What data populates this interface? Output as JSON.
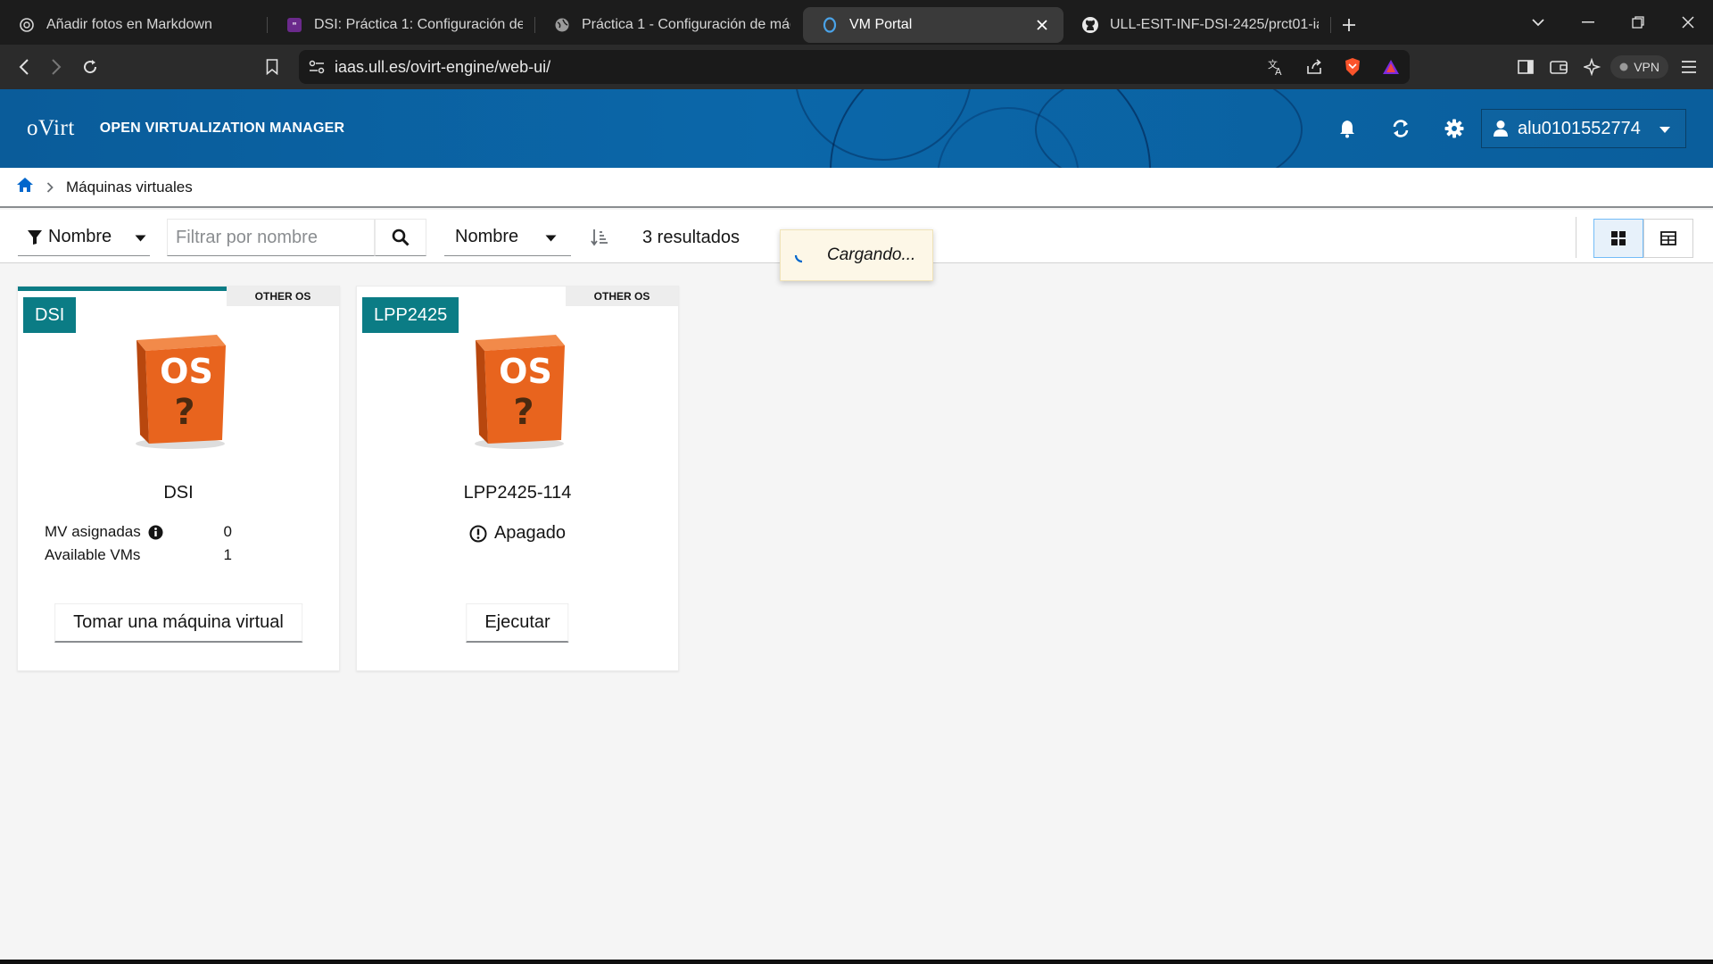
{
  "browser": {
    "tabs": [
      {
        "label": "Añadir fotos en Markdown",
        "icon": "openai-icon"
      },
      {
        "label": "DSI: Práctica 1: Configuración de m",
        "icon": "teams-icon"
      },
      {
        "label": "Práctica 1 - Configuración de máqu",
        "icon": "globe-icon"
      },
      {
        "label": "VM Portal",
        "icon": "ovirt-icon",
        "active": true
      },
      {
        "label": "ULL-ESIT-INF-DSI-2425/prct01-iaas",
        "icon": "github-icon"
      }
    ],
    "url": "iaas.ull.es/ovirt-engine/web-ui/",
    "vpn_label": "VPN"
  },
  "header": {
    "logo": "oVirt",
    "product": "OPEN VIRTUALIZATION MANAGER",
    "username": "alu0101552774"
  },
  "toast": {
    "text": "Cargando..."
  },
  "breadcrumb": {
    "current": "Máquinas virtuales"
  },
  "filter": {
    "field_label": "Nombre",
    "placeholder": "Filtrar por nombre",
    "sort_label": "Nombre",
    "results": "3 resultados"
  },
  "cards": [
    {
      "pool_label": "DSI",
      "os": "OTHER OS",
      "name": "DSI",
      "assigned_label": "MV asignadas",
      "assigned_value": "0",
      "available_label": "Available VMs",
      "available_value": "1",
      "action": "Tomar una máquina virtual"
    },
    {
      "pool_label": "LPP2425",
      "os": "OTHER OS",
      "name": "LPP2425-114",
      "status": "Apagado",
      "action": "Ejecutar"
    }
  ],
  "colors": {
    "masthead": "#0b67a9",
    "accent_teal": "#0b7c85",
    "page_bg": "#f5f5f5",
    "os_box": "#e8641e"
  }
}
